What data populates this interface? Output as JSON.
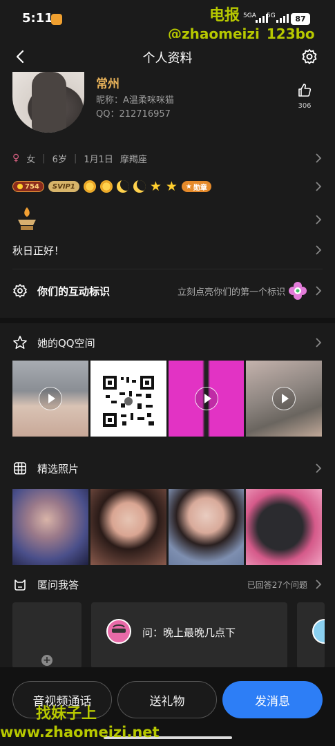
{
  "status_bar": {
    "time": "5:11",
    "network1": "5GA",
    "network2": "5G",
    "battery": "87"
  },
  "watermarks": {
    "top_line1": "电报",
    "top_line2": "@zhaomeizi_123bo",
    "bottom_line1": "找妹子上",
    "bottom_line2": "www.zhaomeizi.net"
  },
  "nav": {
    "title": "个人资料"
  },
  "profile": {
    "city": "常州",
    "nickname": "昵称：A温柔咪咪猫",
    "qq": "QQ：212716957",
    "likes": "306",
    "gender_icon": "female-icon",
    "gender": "女",
    "age": "6岁",
    "birthday": "1月1日",
    "zodiac": "摩羯座",
    "level_badge": "754",
    "svip_badge": "SVIP1",
    "medal_badge": "勋章",
    "signature": "秋日正好！"
  },
  "interaction": {
    "label": "你们的互动标识",
    "hint": "立刻点亮你们的第一个标识"
  },
  "qzone": {
    "title": "她的QQ空间"
  },
  "photos": {
    "title": "精选照片"
  },
  "qa": {
    "title": "匿问我答",
    "answered": "已回答27个问题",
    "question": "问：晚上最晚几点下"
  },
  "actions": {
    "call": "音视频通话",
    "gift": "送礼物",
    "message": "发消息"
  },
  "colors": {
    "accent": "#2d7ef6",
    "city": "#e9b35a",
    "background": "#1b1b1b",
    "watermark": "#b7c800"
  }
}
